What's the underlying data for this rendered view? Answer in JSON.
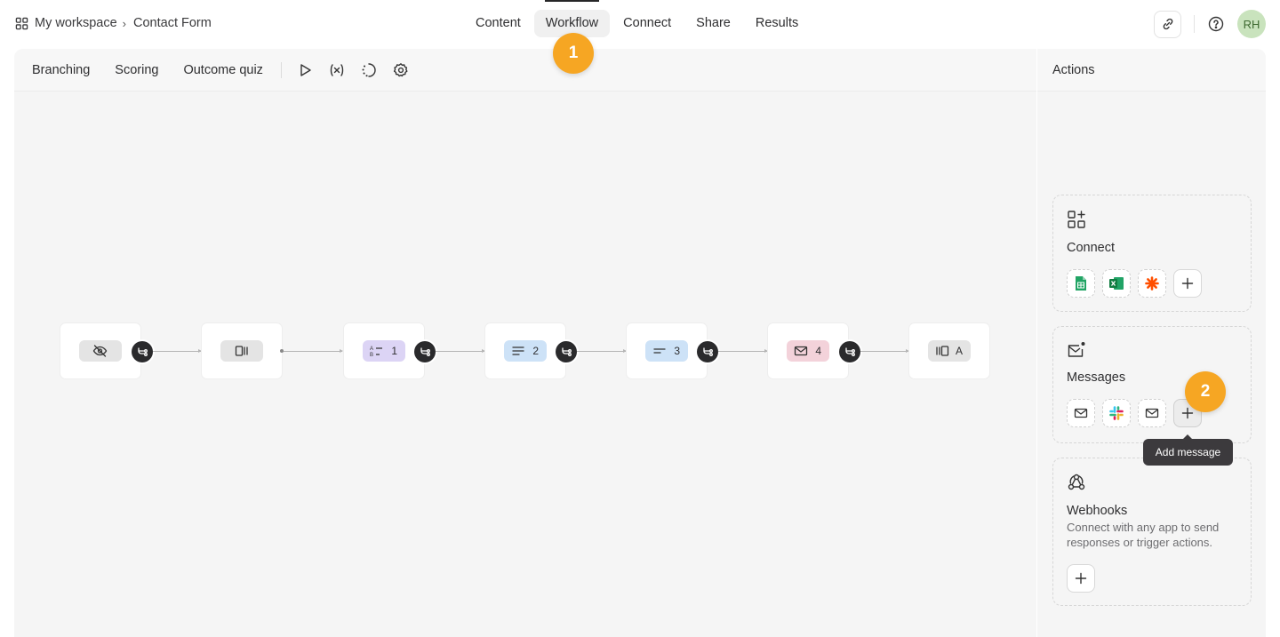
{
  "breadcrumb": {
    "workspace": "My workspace",
    "chevron": "›",
    "form": "Contact Form"
  },
  "nav": {
    "tabs": [
      "Content",
      "Workflow",
      "Connect",
      "Share",
      "Results"
    ],
    "active": "Workflow"
  },
  "user": {
    "initials": "RH"
  },
  "toolbar": {
    "items": [
      "Branching",
      "Scoring",
      "Outcome quiz"
    ]
  },
  "flow": {
    "nodes": [
      {
        "type": "hidden-fields",
        "label": ""
      },
      {
        "type": "welcome-screen",
        "label": ""
      },
      {
        "type": "multiple-choice",
        "label": "1"
      },
      {
        "type": "long-text",
        "label": "2"
      },
      {
        "type": "short-text",
        "label": "3"
      },
      {
        "type": "email",
        "label": "4"
      },
      {
        "type": "ending",
        "label": "A"
      }
    ]
  },
  "actions": {
    "title": "Actions",
    "connect": {
      "title": "Connect",
      "apps": [
        "google-sheets",
        "excel",
        "zapier"
      ]
    },
    "messages": {
      "title": "Messages",
      "apps": [
        "email",
        "slack",
        "email"
      ]
    },
    "webhooks": {
      "title": "Webhooks",
      "description": "Connect with any app to send responses or trigger actions."
    }
  },
  "tooltip": "Add message",
  "steps": [
    "1",
    "2"
  ],
  "colors": {
    "accent": "#f6a623",
    "avatar_bg": "#c9e3bd"
  }
}
